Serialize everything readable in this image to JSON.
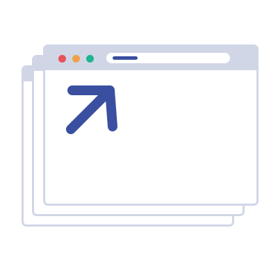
{
  "illustration": {
    "windows": [
      {
        "role": "back-window"
      },
      {
        "role": "middle-window"
      },
      {
        "role": "front-window"
      }
    ],
    "front_window": {
      "controls": [
        "close-dot",
        "minimize-dot",
        "maximize-dot"
      ],
      "address_bar": {
        "text": ""
      }
    },
    "content_icon": "arrow-up-right-icon"
  },
  "colors": {
    "frame": "#d1d6e6",
    "window_bg": "#ffffff",
    "close": "#e8505b",
    "minimize": "#f0a04b",
    "maximize": "#1fb58f",
    "accent": "#3a4fa0"
  }
}
